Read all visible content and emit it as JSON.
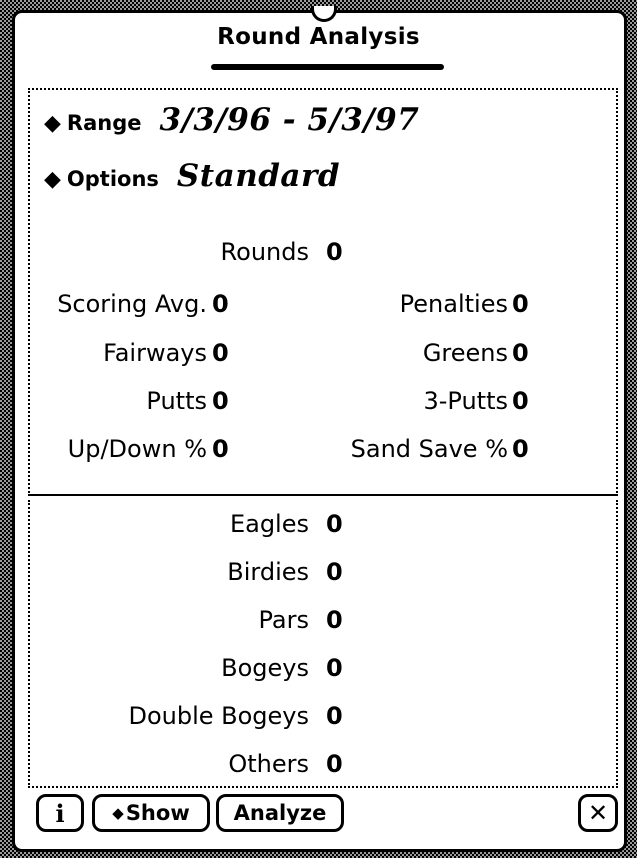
{
  "window": {
    "title": "Round Analysis"
  },
  "pickers": {
    "range": {
      "label": "Range",
      "value": "3/3/96 - 5/3/97"
    },
    "options": {
      "label": "Options",
      "value": "Standard"
    }
  },
  "summary": {
    "rounds": {
      "label": "Rounds",
      "value": "0"
    },
    "scoring_avg": {
      "label": "Scoring Avg.",
      "value": "0"
    },
    "penalties": {
      "label": "Penalties",
      "value": "0"
    },
    "fairways": {
      "label": "Fairways",
      "value": "0"
    },
    "greens": {
      "label": "Greens",
      "value": "0"
    },
    "putts": {
      "label": "Putts",
      "value": "0"
    },
    "three_putts": {
      "label": "3-Putts",
      "value": "0"
    },
    "up_down": {
      "label": "Up/Down %",
      "value": "0"
    },
    "sand_save": {
      "label": "Sand Save %",
      "value": "0"
    }
  },
  "scores": {
    "eagles": {
      "label": "Eagles",
      "value": "0"
    },
    "birdies": {
      "label": "Birdies",
      "value": "0"
    },
    "pars": {
      "label": "Pars",
      "value": "0"
    },
    "bogeys": {
      "label": "Bogeys",
      "value": "0"
    },
    "double_bogeys": {
      "label": "Double Bogeys",
      "value": "0"
    },
    "others": {
      "label": "Others",
      "value": "0"
    }
  },
  "buttons": {
    "info": "i",
    "show": "Show",
    "analyze": "Analyze",
    "close": "✕"
  },
  "icons": {
    "picker_diamond": "diamond-icon",
    "close": "close-icon",
    "info": "info-icon"
  }
}
